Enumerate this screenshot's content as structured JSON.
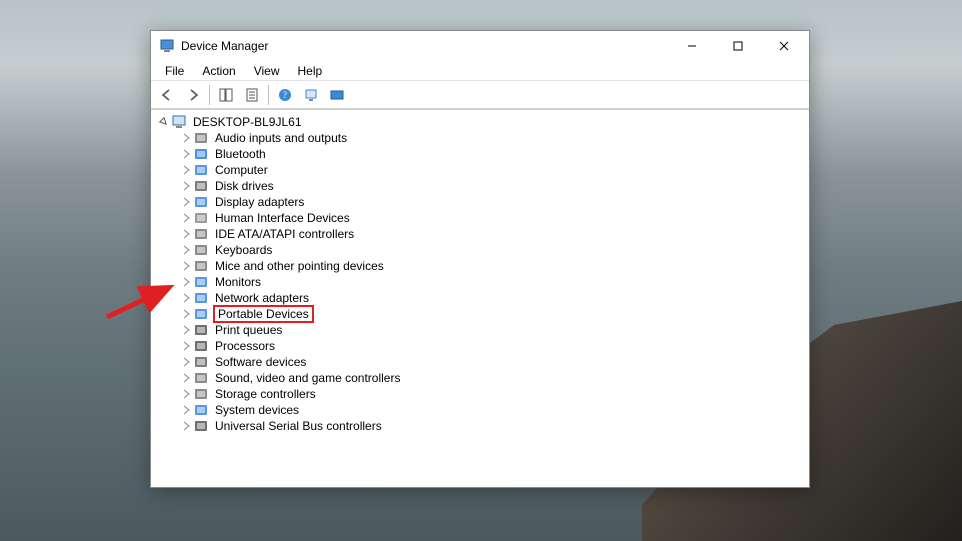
{
  "window": {
    "title": "Device Manager"
  },
  "menu": {
    "file": "File",
    "action": "Action",
    "view": "View",
    "help": "Help"
  },
  "tree": {
    "root": "DESKTOP-BL9JL61",
    "items": [
      {
        "label": "Audio inputs and outputs"
      },
      {
        "label": "Bluetooth"
      },
      {
        "label": "Computer"
      },
      {
        "label": "Disk drives"
      },
      {
        "label": "Display adapters"
      },
      {
        "label": "Human Interface Devices"
      },
      {
        "label": "IDE ATA/ATAPI controllers"
      },
      {
        "label": "Keyboards"
      },
      {
        "label": "Mice and other pointing devices"
      },
      {
        "label": "Monitors"
      },
      {
        "label": "Network adapters"
      },
      {
        "label": "Portable Devices",
        "highlighted": true
      },
      {
        "label": "Print queues"
      },
      {
        "label": "Processors"
      },
      {
        "label": "Software devices"
      },
      {
        "label": "Sound, video and game controllers"
      },
      {
        "label": "Storage controllers"
      },
      {
        "label": "System devices"
      },
      {
        "label": "Universal Serial Bus controllers"
      }
    ]
  }
}
